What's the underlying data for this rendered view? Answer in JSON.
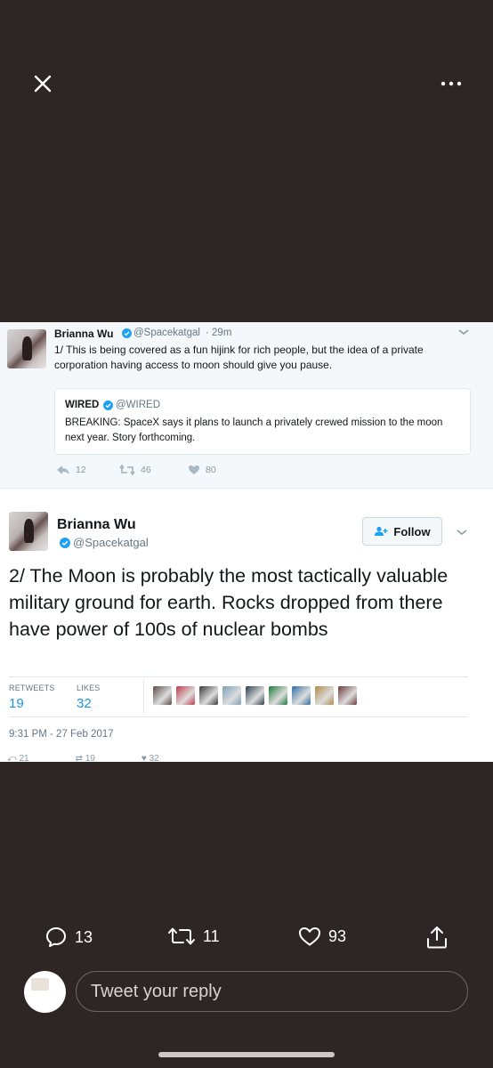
{
  "viewer": {
    "close_icon": "close-icon",
    "more_icon": "more-horizontal-icon"
  },
  "previous_tweet": {
    "name": "Brianna Wu",
    "handle": "@Spacekatgal",
    "time": "· 29m",
    "text": "1/ This is being covered as a fun hijink for rich people, but the idea of a private corporation having access to moon should give you pause.",
    "quote": {
      "name": "WIRED",
      "handle": "@WIRED",
      "text": "BREAKING: SpaceX says it plans to launch a privately crewed mission to the moon next year. Story forthcoming."
    },
    "replies": "12",
    "retweets": "46",
    "likes": "80"
  },
  "main_tweet": {
    "name": "Brianna Wu",
    "handle": "@Spacekatgal",
    "follow_label": "Follow",
    "text": "2/ The Moon is probably the most tactically valuable military ground for earth. Rocks dropped from there have power of 100s of nuclear bombs",
    "retweets_label": "RETWEETS",
    "retweets": "19",
    "likes_label": "LIKES",
    "likes": "32",
    "timestamp": "9:31 PM - 27 Feb 2017",
    "cut_replies": "21",
    "cut_retweets": "19",
    "cut_likes": "32"
  },
  "likers_colors": [
    "#5a4a44",
    "#c23a4a",
    "#3a3a3a",
    "#7aa0b8",
    "#2c3e50",
    "#1e7a3a",
    "#2d6fa3",
    "#b08a4a",
    "#6b3b3b"
  ],
  "action_bar": {
    "replies": "13",
    "retweets": "11",
    "likes": "93"
  },
  "reply_input": {
    "placeholder": "Tweet your reply"
  },
  "colors": {
    "background": "#2e2624",
    "link_blue": "#1b95e0",
    "verified_blue": "#1da1f2"
  }
}
